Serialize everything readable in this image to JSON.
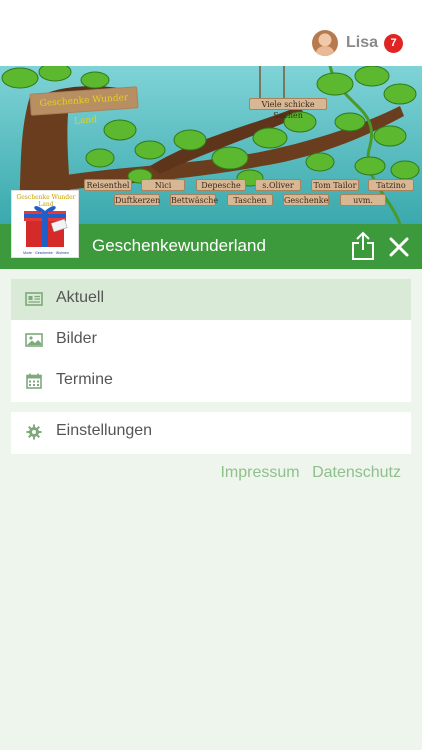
{
  "header": {
    "user_name": "Lisa",
    "notification_count": "7"
  },
  "banner": {
    "title_sign": "Geschenke Wunder Land",
    "hanging_sign": "Viele schicke Sachen",
    "brands_row1": [
      "Reisenthel",
      "Nici",
      "Depesche",
      "s.Oliver",
      "Tom Tailor",
      "Tatzino"
    ],
    "brands_row2": [
      "Duftkerzen",
      "Bettwäsche",
      "Taschen",
      "Geschenke",
      "uvm."
    ]
  },
  "logo": {
    "title": "Geschenke Wunder Land",
    "tagline": "Mode · Geschenke · Wohnen"
  },
  "shop": {
    "name": "Geschenkewunderland"
  },
  "menu": {
    "items": [
      {
        "label": "Aktuell",
        "icon": "news-icon"
      },
      {
        "label": "Bilder",
        "icon": "image-icon"
      },
      {
        "label": "Termine",
        "icon": "calendar-icon"
      }
    ],
    "settings": {
      "label": "Einstellungen",
      "icon": "gear-icon"
    }
  },
  "footer_links": {
    "impressum": "Impressum",
    "datenschutz": "Datenschutz"
  },
  "colors": {
    "accent_green": "#3d9a3c",
    "active_row": "#d9ebd7",
    "link_green": "#8fbf8c",
    "badge_red": "#e02424",
    "page_bg": "#eef5ec"
  }
}
